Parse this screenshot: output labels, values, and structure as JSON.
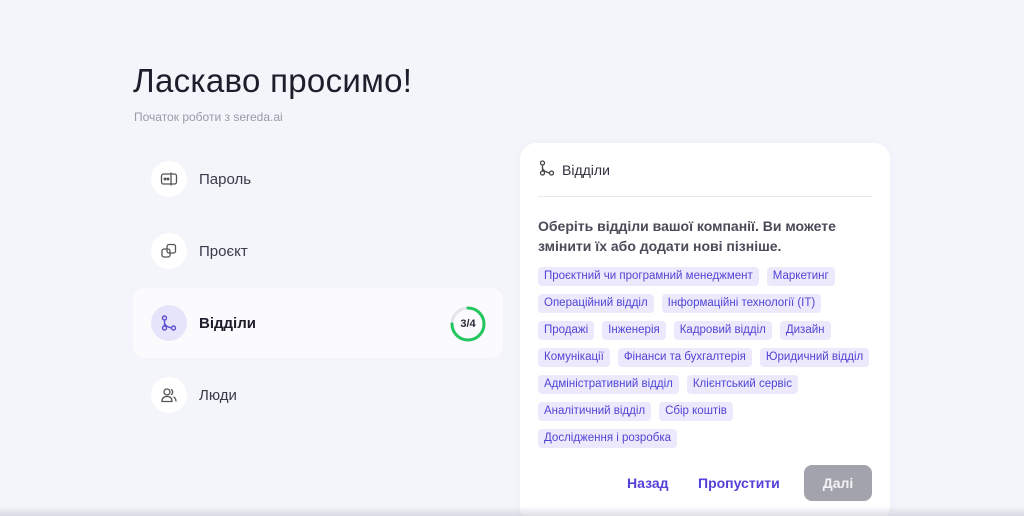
{
  "header": {
    "title": "Ласкаво просимо!",
    "subtitle": "Початок роботи з sereda.ai"
  },
  "steps": [
    {
      "label": "Пароль",
      "icon": "password-icon",
      "active": false
    },
    {
      "label": "Проєкт",
      "icon": "project-icon",
      "active": false
    },
    {
      "label": "Відділи",
      "icon": "departments-icon",
      "active": true,
      "progress": "3/4",
      "progress_fraction": 0.75
    },
    {
      "label": "Люди",
      "icon": "people-icon",
      "active": false
    }
  ],
  "card": {
    "title": "Відділи",
    "description": "Оберіть відділи вашої компанії. Ви можете змінити їх або додати нові пізніше.",
    "departments": [
      "Проєктний чи програмний менеджмент",
      "Маркетинг",
      "Операційний відділ",
      "Інформаційні технології (IT)",
      "Продажі",
      "Інженерія",
      "Кадровий відділ",
      "Дизайн",
      "Комунікації",
      "Фінанси та бухгалтерія",
      "Юридичний відділ",
      "Адміністративний відділ",
      "Клієнтський сервіс",
      "Аналітичний відділ",
      "Сбір коштів",
      "Дослідження і розробка"
    ],
    "back_label": "Назад",
    "skip_label": "Пропустити",
    "next_label": "Далі"
  },
  "colors": {
    "accent": "#5242d9",
    "chip_bg": "#ebe9fb",
    "progress": "#22c55e",
    "disabled_button": "#a3a3ad"
  }
}
